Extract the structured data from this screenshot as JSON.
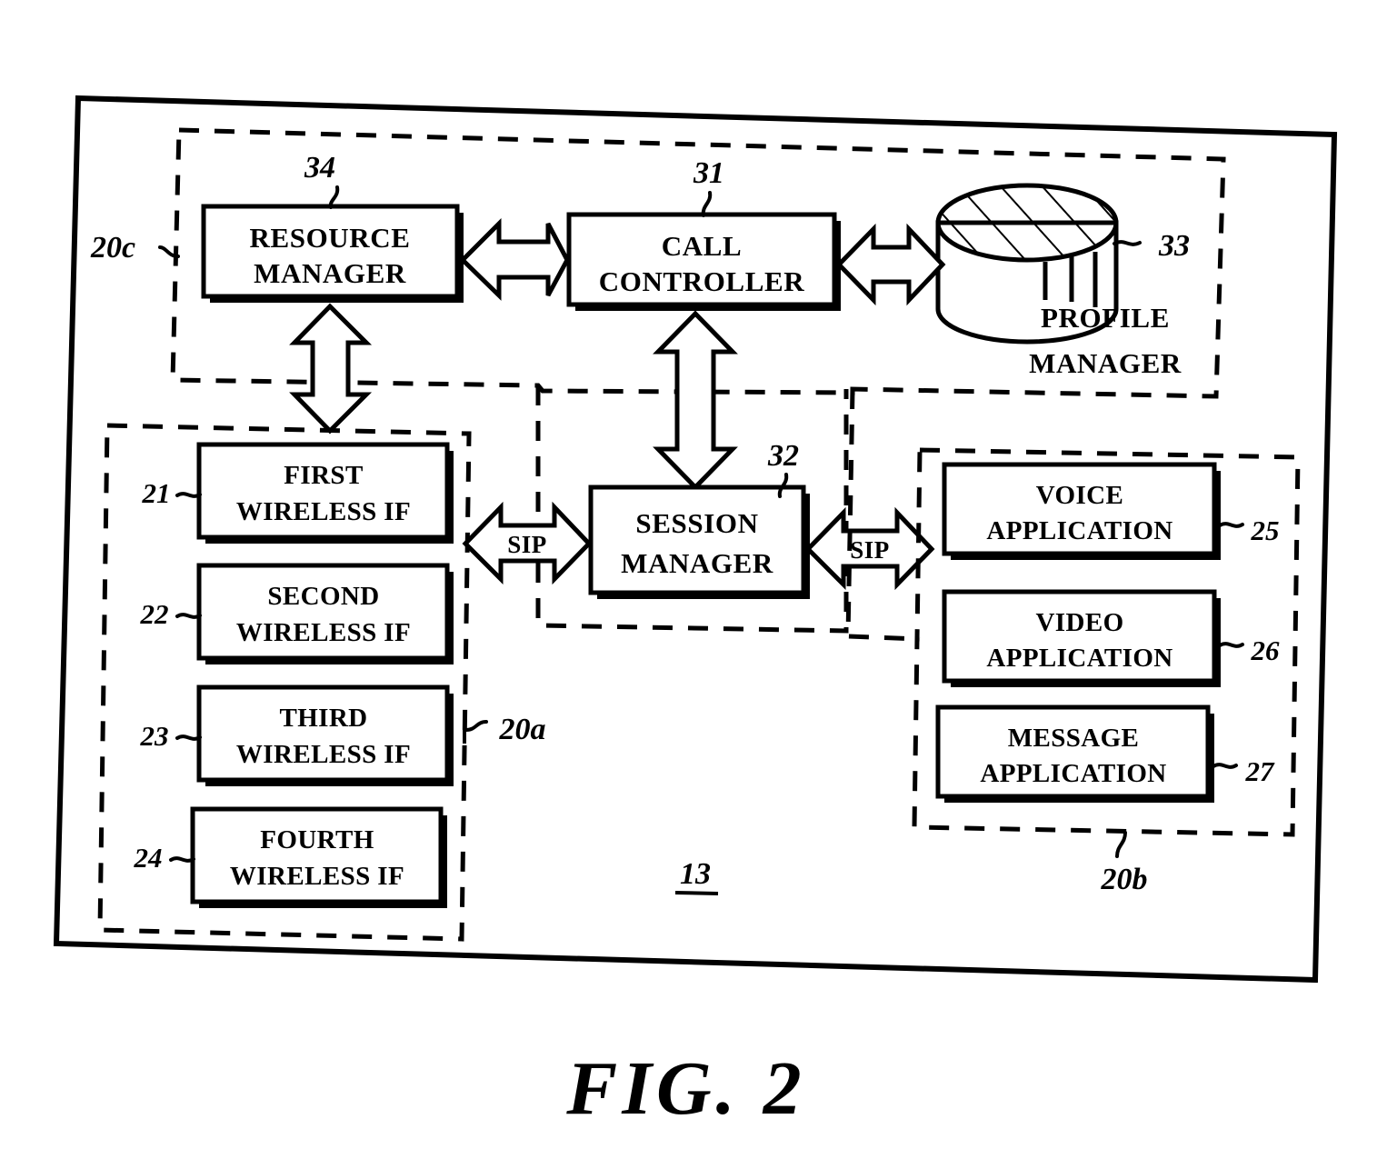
{
  "figure": {
    "caption": "FIG. 2",
    "system_ref": "13"
  },
  "regions": [
    {
      "id": "region-20c",
      "label": "20c"
    },
    {
      "id": "region-20a",
      "label": "20a"
    },
    {
      "id": "region-20b",
      "label": "20b"
    }
  ],
  "blocks": [
    {
      "id": "resource-manager",
      "line1": "RESOURCE",
      "line2": "MANAGER",
      "ref": "34"
    },
    {
      "id": "call-controller",
      "line1": "CALL",
      "line2": "CONTROLLER",
      "ref": "31"
    },
    {
      "id": "profile-manager",
      "line1": "PROFILE",
      "line2": "MANAGER",
      "ref": "33"
    },
    {
      "id": "session-manager",
      "line1": "SESSION",
      "line2": "MANAGER",
      "ref": "32"
    },
    {
      "id": "first-wireless-if",
      "line1": "FIRST",
      "line2": "WIRELESS IF",
      "ref": "21"
    },
    {
      "id": "second-wireless-if",
      "line1": "SECOND",
      "line2": "WIRELESS IF",
      "ref": "22"
    },
    {
      "id": "third-wireless-if",
      "line1": "THIRD",
      "line2": "WIRELESS IF",
      "ref": "23"
    },
    {
      "id": "fourth-wireless-if",
      "line1": "FOURTH",
      "line2": "WIRELESS IF",
      "ref": "24"
    },
    {
      "id": "voice-application",
      "line1": "VOICE",
      "line2": "APPLICATION",
      "ref": "25"
    },
    {
      "id": "video-application",
      "line1": "VIDEO",
      "line2": "APPLICATION",
      "ref": "26"
    },
    {
      "id": "message-application",
      "line1": "MESSAGE",
      "line2": "APPLICATION",
      "ref": "27"
    }
  ],
  "connectors": [
    {
      "id": "sip-left",
      "label": "SIP"
    },
    {
      "id": "sip-right",
      "label": "SIP"
    }
  ],
  "colors": {
    "ink": "#000000",
    "paper": "#ffffff"
  }
}
